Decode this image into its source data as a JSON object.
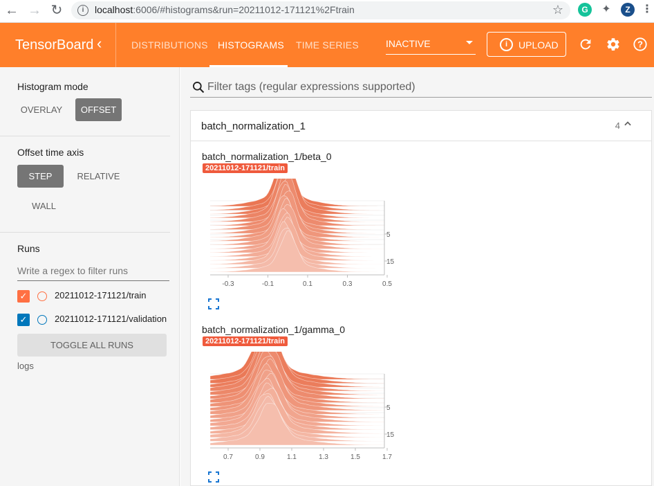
{
  "browser": {
    "url_host": "localhost",
    "url_rest": ":6006/#histograms&run=20211012-171121%2Ftrain",
    "avatar_letter": "Z"
  },
  "header": {
    "brand": "TensorBoard",
    "tabs": [
      {
        "label": "DISTRIBUTIONS",
        "active": false
      },
      {
        "label": "HISTOGRAMS",
        "active": true
      },
      {
        "label": "TIME SERIES",
        "active": false
      }
    ],
    "plugin_select": "INACTIVE",
    "upload_label": "UPLOAD",
    "accent": "#ff7f2a"
  },
  "sidebar": {
    "histogram_mode": {
      "title": "Histogram mode",
      "options": [
        "OVERLAY",
        "OFFSET"
      ],
      "selected": "OFFSET"
    },
    "offset_axis": {
      "title": "Offset time axis",
      "options": [
        "STEP",
        "RELATIVE",
        "WALL"
      ],
      "selected": "STEP"
    },
    "runs": {
      "title": "Runs",
      "filter_placeholder": "Write a regex to filter runs",
      "items": [
        {
          "name": "20211012-171121/train",
          "checked": true,
          "color": "#ff7043"
        },
        {
          "name": "20211012-171121/validation",
          "checked": true,
          "color": "#0077bb"
        }
      ],
      "toggle_all": "TOGGLE ALL RUNS",
      "logdir": "logs"
    }
  },
  "main": {
    "tag_filter_placeholder": "Filter tags (regular expressions supported)",
    "card": {
      "title": "batch_normalization_1",
      "count": "4"
    },
    "charts": [
      {
        "title": "batch_normalization_1/beta_0",
        "run": "20211012-171121/train",
        "x_ticks": [
          "-0.3",
          "-0.1",
          "0.1",
          "0.3",
          "0.5"
        ],
        "y_ticks": [
          "5",
          "15"
        ]
      },
      {
        "title": "batch_normalization_1/gamma_0",
        "run": "20211012-171121/train",
        "x_ticks": [
          "0.7",
          "0.9",
          "1.1",
          "1.3",
          "1.5",
          "1.7"
        ],
        "y_ticks": [
          "5",
          "15"
        ]
      }
    ]
  }
}
